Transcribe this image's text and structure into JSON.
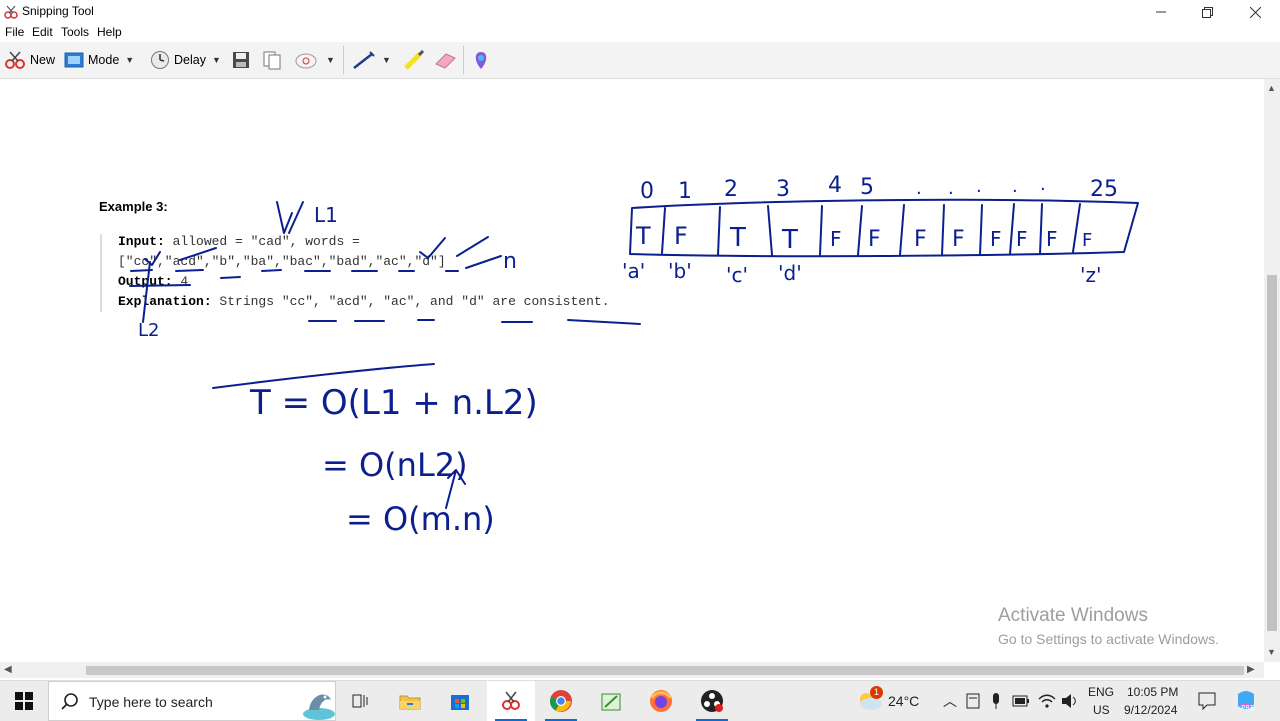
{
  "window": {
    "title": "Snipping Tool"
  },
  "menu": [
    "File",
    "Edit",
    "Tools",
    "Help"
  ],
  "toolbar": {
    "new_label": "New",
    "mode_label": "Mode",
    "delay_label": "Delay"
  },
  "content": {
    "example_title": "Example 3:",
    "input_label": "Input:",
    "input_line1": " allowed = \"cad\", words =",
    "input_line2": "[\"cc\",\"acd\",\"b\",\"ba\",\"bac\",\"bad\",\"ac\",\"d\"]",
    "output_label": "Output:",
    "output_value": " 4",
    "explanation_label": "Explanation:",
    "explanation_text": " Strings \"cc\", \"acd\", \"ac\", and \"d\" are consistent."
  },
  "notes": {
    "L1": "L1",
    "L2": "L2",
    "n": "n",
    "indices": [
      "0",
      "1",
      "2",
      "3",
      "4",
      "5",
      ".",
      ".",
      ".",
      ".",
      ".",
      "25"
    ],
    "cells": [
      "T",
      "F",
      "T",
      "T",
      "F",
      "F",
      "F",
      "F",
      "F",
      "F",
      "F",
      "F"
    ],
    "letters": [
      "'a'",
      "'b'",
      "'c'",
      "'d'",
      "'z'"
    ],
    "eq1": "T = O(L1 + n.L2)",
    "eq2": "= O(nL2)",
    "eq3": "= O(m.n)"
  },
  "watermark": {
    "line1": "Activate Windows",
    "line2": "Go to Settings to activate Windows."
  },
  "taskbar": {
    "search_placeholder": "Type here to search",
    "weather_badge": "1",
    "temperature": "24°C",
    "lang1": "ENG",
    "lang2": "US",
    "time": "10:05 PM",
    "date": "9/12/2024",
    "accent": "#0a6cd6"
  },
  "ink_color": "#0b1f8f"
}
